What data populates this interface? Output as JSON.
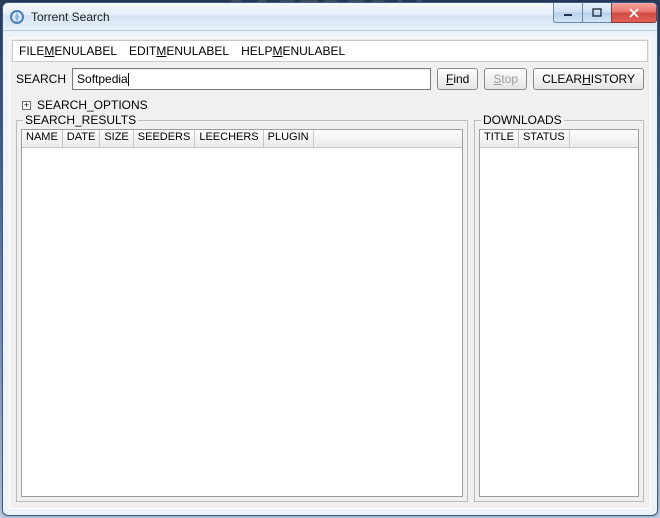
{
  "watermark": "SOFTPEDIA",
  "title": "Torrent Search",
  "menu": {
    "file": {
      "pre": "FILE",
      "ul": "M",
      "post": "ENULABEL"
    },
    "edit": {
      "pre": "EDIT",
      "ul": "M",
      "post": "ENULABEL"
    },
    "help": {
      "pre": "HELP",
      "ul": "M",
      "post": "ENULABEL"
    }
  },
  "search": {
    "label": "SEARCH",
    "value": "Softpedia",
    "find": {
      "ul": "F",
      "post": "ind"
    },
    "stop": {
      "ul": "S",
      "post": "top"
    },
    "clear": {
      "pre": "CLEAR",
      "ul": "H",
      "post": "ISTORY"
    }
  },
  "options": {
    "icon": "+",
    "label": "SEARCH_OPTIONS"
  },
  "results": {
    "title": "SEARCH_RESULTS",
    "columns": [
      "NAME",
      "DATE",
      "SIZE",
      "SEEDERS",
      "LEECHERS",
      "PLUGIN"
    ]
  },
  "downloads": {
    "title": "DOWNLOADS",
    "columns": [
      "TITLE",
      "STATUS"
    ]
  }
}
